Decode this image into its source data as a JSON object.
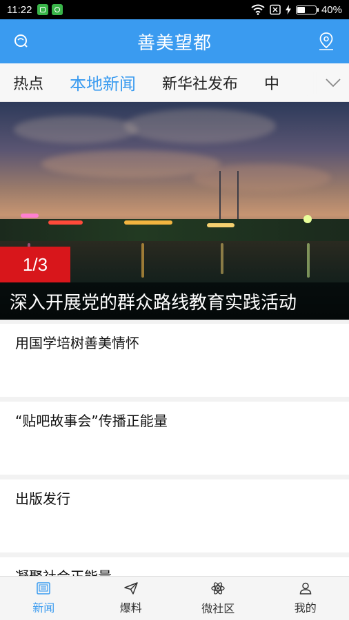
{
  "status_bar": {
    "time": "11:22",
    "battery": "40%",
    "battery_level": 0.4
  },
  "header": {
    "title": "善美望都",
    "left_icon": "chat-bubble-icon",
    "right_icon": "location-pin-icon"
  },
  "tabs": [
    {
      "label": "热点",
      "active": false
    },
    {
      "label": "本地新闻",
      "active": true
    },
    {
      "label": "新华社发布",
      "active": false
    },
    {
      "label": "中",
      "active": false
    }
  ],
  "banner": {
    "counter": "1/3",
    "caption": "深入开展党的群众路线教育实践活动"
  },
  "news": [
    {
      "title": "用国学培树善美情怀"
    },
    {
      "title": "“贴吧故事会”传播正能量"
    },
    {
      "title": "出版发行"
    },
    {
      "title": "凝聚社会正能量"
    }
  ],
  "bottom_nav": [
    {
      "label": "新闻",
      "icon": "news-icon",
      "active": true
    },
    {
      "label": "爆料",
      "icon": "paper-plane-icon",
      "active": false
    },
    {
      "label": "微社区",
      "icon": "atom-icon",
      "active": false
    },
    {
      "label": "我的",
      "icon": "user-icon",
      "active": false
    }
  ],
  "colors": {
    "accent": "#3a9bf0",
    "counter_bg": "#d8161b"
  }
}
